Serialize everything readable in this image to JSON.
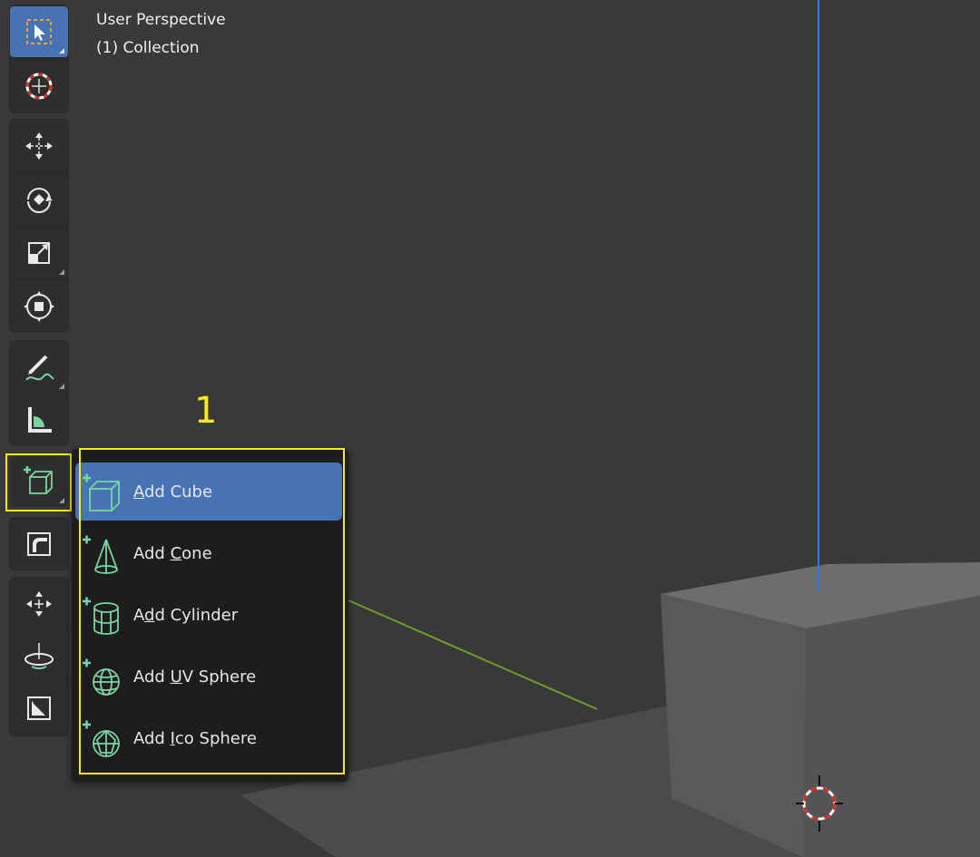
{
  "viewport": {
    "perspective_label": "User Perspective",
    "collection_label": "(1) Collection"
  },
  "toolbar": {
    "tools": [
      {
        "name": "Select Box",
        "icon": "select-box-icon",
        "active": true
      },
      {
        "name": "Cursor",
        "icon": "cursor-icon"
      },
      {
        "name": "Move",
        "icon": "move-icon"
      },
      {
        "name": "Rotate",
        "icon": "rotate-icon"
      },
      {
        "name": "Scale",
        "icon": "scale-icon"
      },
      {
        "name": "Transform",
        "icon": "transform-icon"
      },
      {
        "name": "Annotate",
        "icon": "annotate-icon"
      },
      {
        "name": "Measure",
        "icon": "measure-icon"
      },
      {
        "name": "Add Cube",
        "icon": "add-cube-icon",
        "highlighted": true
      },
      {
        "name": "Extrude",
        "icon": "extrude-icon"
      },
      {
        "name": "Move",
        "icon": "move-view-icon"
      },
      {
        "name": "Rotate",
        "icon": "spin-icon"
      },
      {
        "name": "Scale",
        "icon": "shrink-icon"
      }
    ]
  },
  "annotation": {
    "marker": "1",
    "color": "#f5ea1c"
  },
  "add_menu": {
    "items": [
      {
        "pre": "",
        "key": "A",
        "post": "dd Cube",
        "icon": "cube-add-icon",
        "active": true
      },
      {
        "pre": "Add ",
        "key": "C",
        "post": "one",
        "icon": "cone-add-icon"
      },
      {
        "pre": "A",
        "key": "d",
        "post": "d Cylinder",
        "icon": "cylinder-add-icon"
      },
      {
        "pre": "Add ",
        "key": "U",
        "post": "V Sphere",
        "icon": "uv-sphere-add-icon"
      },
      {
        "pre": "Add ",
        "key": "I",
        "post": "co Sphere",
        "icon": "ico-sphere-add-icon"
      }
    ]
  },
  "colors": {
    "accent": "#4772b3",
    "icon_green": "#7ad5a3",
    "axis_z": "#3a74d4",
    "axis_y": "#6f9d2a",
    "viewport_bg": "#393939"
  }
}
